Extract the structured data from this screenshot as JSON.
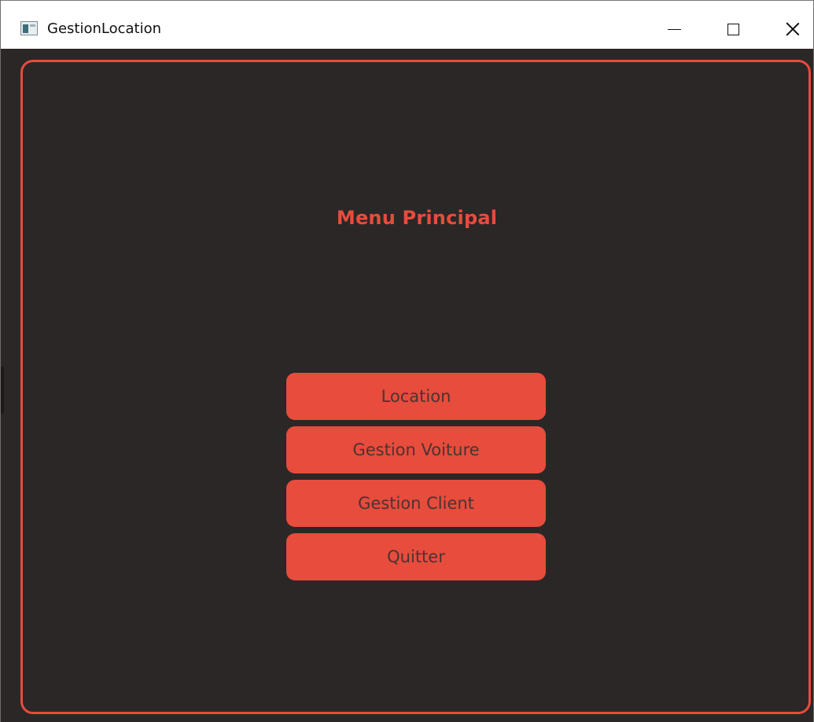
{
  "window": {
    "title": "GestionLocation",
    "icon": "app-window-icon",
    "controls": [
      "minimize-icon",
      "maximize-icon",
      "close-icon"
    ]
  },
  "main": {
    "heading": "Menu Principal",
    "buttons": [
      {
        "label": "Location"
      },
      {
        "label": "Gestion Voiture"
      },
      {
        "label": "Gestion Client"
      },
      {
        "label": "Quitter"
      }
    ]
  },
  "colors": {
    "background": "#2b2726",
    "accent": "#e74c3c",
    "button_text": "#4a3431",
    "titlebar": "#ffffff"
  }
}
